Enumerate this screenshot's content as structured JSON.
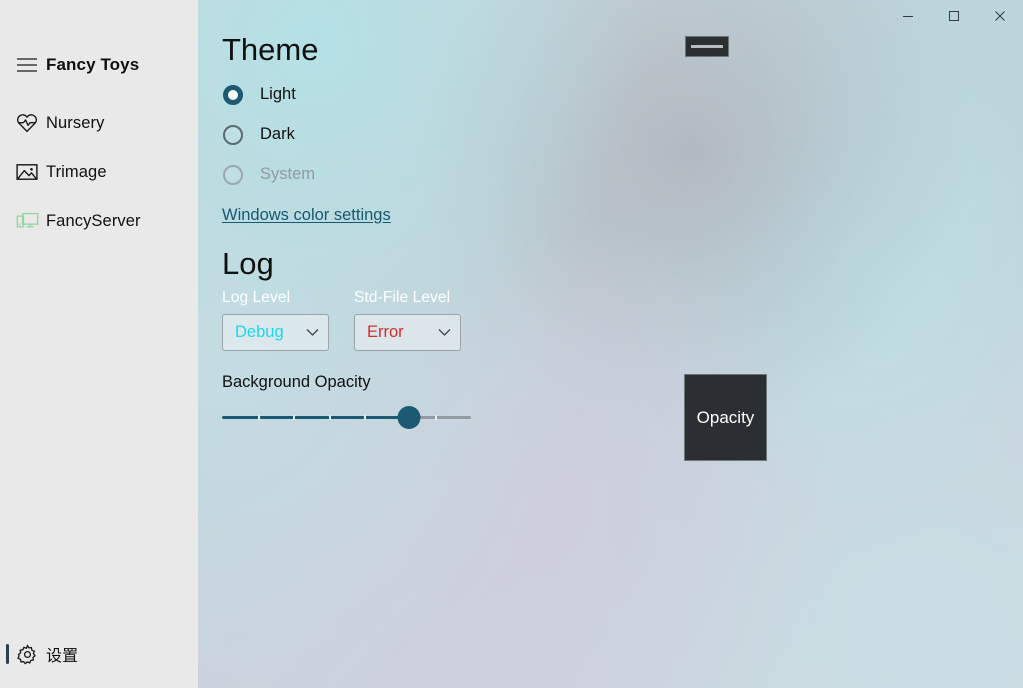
{
  "window": {
    "caption_buttons": [
      {
        "name": "minimize",
        "label": "—"
      },
      {
        "name": "maximize",
        "label": "☐"
      },
      {
        "name": "close",
        "label": "✕"
      }
    ]
  },
  "sidebar": {
    "app_title": "Fancy Toys",
    "hamburger_icon": "hamburger-menu-icon",
    "items": [
      {
        "label": "Nursery",
        "icon": "heart-pulse-icon",
        "selected": false
      },
      {
        "label": "Trimage",
        "icon": "image-icon",
        "selected": false
      },
      {
        "label": "FancyServer",
        "icon": "devices-icon",
        "selected": false
      }
    ],
    "settings": {
      "label": "设置",
      "icon": "gear-icon",
      "selected": true
    }
  },
  "main": {
    "theme": {
      "title": "Theme",
      "options": [
        {
          "label": "Light",
          "checked": true,
          "disabled": false
        },
        {
          "label": "Dark",
          "checked": false,
          "disabled": false
        },
        {
          "label": "System",
          "checked": false,
          "disabled": true
        }
      ],
      "color_link": "Windows color settings"
    },
    "log": {
      "title": "Log",
      "log_level": {
        "label": "Log Level",
        "value": "Debug",
        "value_color": "#1ad6ef",
        "chevron_icon": "chevron-down-icon"
      },
      "std_file_level": {
        "label": "Std-File Level",
        "value": "Error",
        "value_color": "#d42d2d",
        "chevron_icon": "chevron-down-icon"
      }
    },
    "opacity": {
      "label": "Background Opacity",
      "value_percent": 75,
      "min": 0,
      "max": 100,
      "tick_count": 6
    }
  },
  "tooltips": {
    "opacity": "Opacity"
  },
  "colors": {
    "accent": "#1b5a72",
    "sidebar_bg": "#e9e9e9",
    "link": "#16586e",
    "tooltip_bg": "#2b2f31",
    "selection_bar": "#2c3e50",
    "fancyserver_icon": "#8fd8a0"
  }
}
